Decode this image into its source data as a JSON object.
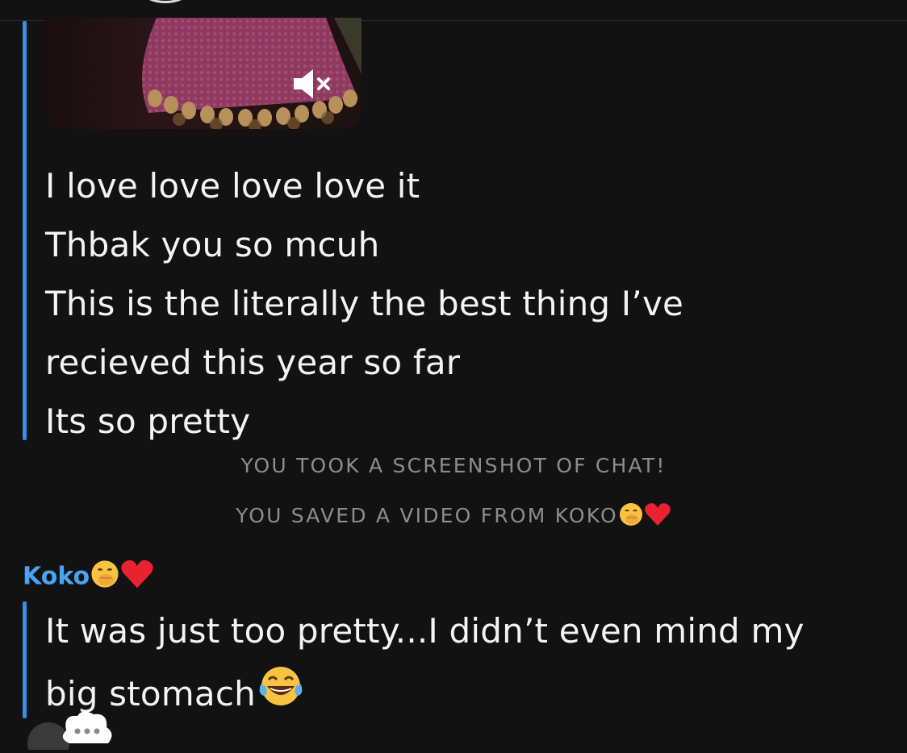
{
  "chat": {
    "block1": {
      "media": {
        "type": "video",
        "mute_icon": "speaker-muted-icon"
      },
      "lines": [
        "I love love love love it",
        "Thbak you so mcuh",
        "This is the literally the best thing I’ve",
        "recieved this year so far",
        "Its so pretty"
      ]
    },
    "system_notes": {
      "screenshot": "YOU TOOK A SCREENSHOT OF CHAT!",
      "saved_video": "YOU SAVED A VIDEO FROM KOKO"
    },
    "sender": {
      "name": "Koko",
      "emoji_icons": [
        "hand-over-mouth-emoji-icon",
        "red-heart-icon"
      ]
    },
    "block2": {
      "lines": [
        "It was just too pretty...I didn’t even mind my",
        "big stomach"
      ],
      "trailing_emoji": "tears-of-joy-emoji-icon"
    },
    "typing_indicator": {
      "icon": "typing-bubble-icon"
    },
    "colors": {
      "background": "#121212",
      "accent_bar": "#3a8ee6",
      "sender_name": "#4aa3f0",
      "system_text": "#8c8c8c",
      "message_text": "#f3f3f3"
    }
  }
}
